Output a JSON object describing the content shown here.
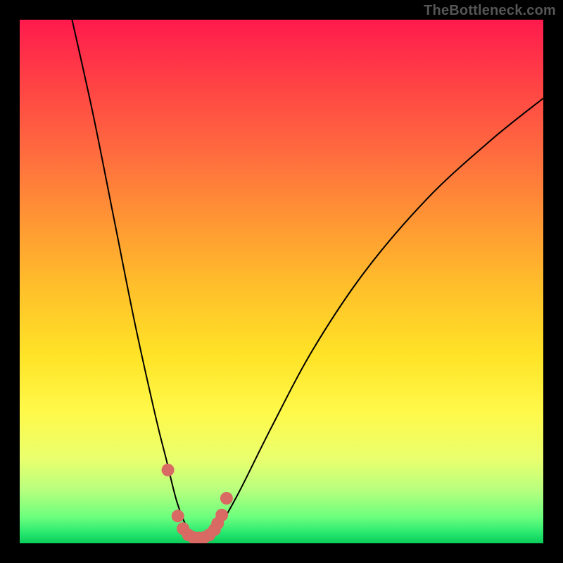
{
  "watermark": "TheBottleneck.com",
  "chart_data": {
    "type": "line",
    "title": "",
    "xlabel": "",
    "ylabel": "",
    "xlim": [
      0,
      100
    ],
    "ylim": [
      0,
      100
    ],
    "background_gradient": {
      "direction": "top-to-bottom",
      "stops": [
        {
          "pos": 0,
          "color": "#ff1a4d"
        },
        {
          "pos": 25,
          "color": "#ff6a3f"
        },
        {
          "pos": 52,
          "color": "#ffc22a"
        },
        {
          "pos": 75,
          "color": "#fff94a"
        },
        {
          "pos": 95,
          "color": "#6cff7e"
        },
        {
          "pos": 100,
          "color": "#0acc5a"
        }
      ]
    },
    "series": [
      {
        "name": "bottleneck-curve",
        "stroke": "#000000",
        "stroke_width": 2,
        "x": [
          10,
          14,
          18,
          22,
          26,
          28,
          30,
          32,
          34,
          36,
          38,
          42,
          48,
          56,
          66,
          78,
          90,
          100
        ],
        "y": [
          100,
          82,
          62,
          42,
          24,
          16,
          8,
          3,
          1,
          1,
          3,
          10,
          22,
          37,
          52,
          66,
          77,
          85
        ]
      },
      {
        "name": "highlight-dots",
        "stroke": "#d86a63",
        "marker": "circle",
        "marker_radius_px": 9,
        "x": [
          28.3,
          30.2,
          31.2,
          32.2,
          33.2,
          34.2,
          35.2,
          36.2,
          37.2,
          37.8,
          38.6,
          39.5
        ],
        "y": [
          14.0,
          5.2,
          2.8,
          1.6,
          1.1,
          1.0,
          1.1,
          1.6,
          2.6,
          3.8,
          5.4,
          8.6
        ]
      }
    ]
  }
}
